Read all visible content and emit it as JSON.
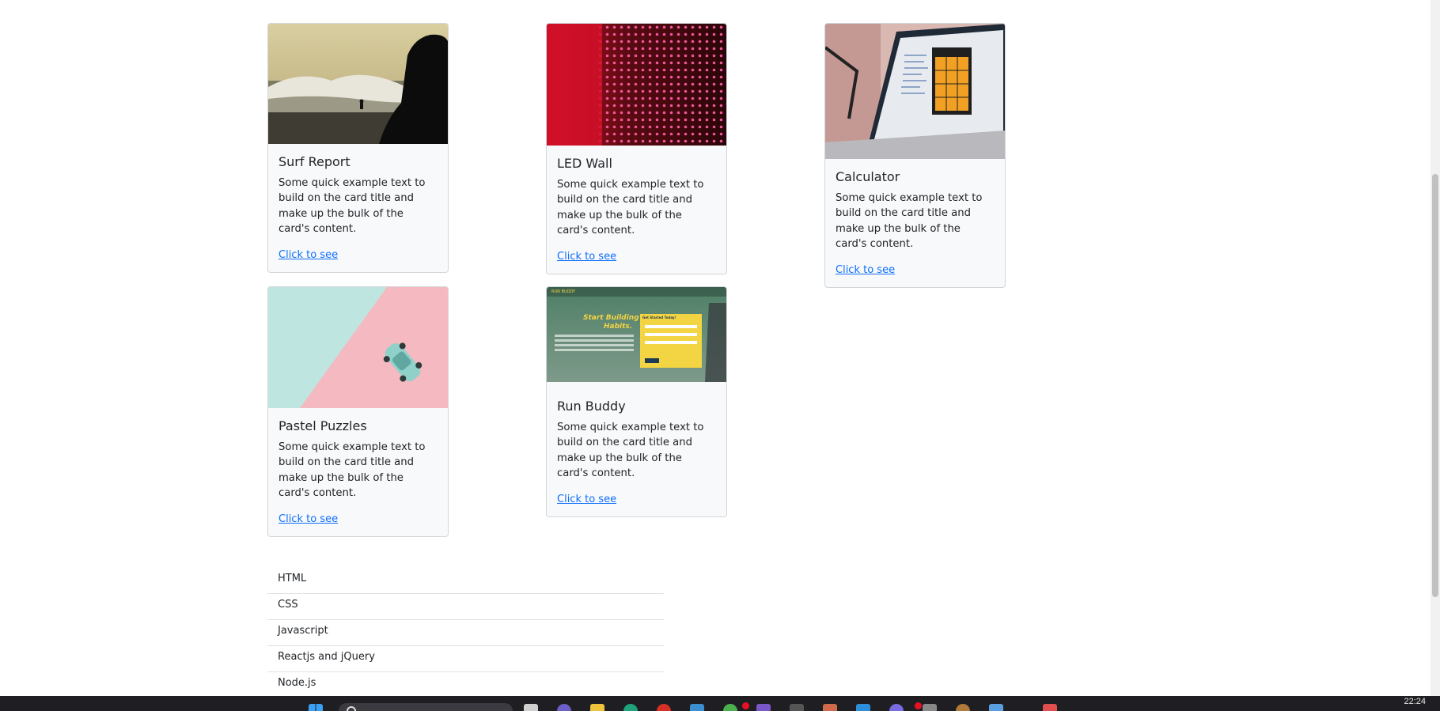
{
  "cards": [
    {
      "title": "Surf Report",
      "text": "Some quick example text to build on the card title and make up the bulk of the card's content.",
      "link": "Click to see"
    },
    {
      "title": "LED Wall",
      "text": "Some quick example text to build on the card title and make up the bulk of the card's content.",
      "link": "Click to see"
    },
    {
      "title": "Calculator",
      "text": "Some quick example text to build on the card title and make up the bulk of the card's content.",
      "link": "Click to see"
    },
    {
      "title": "Pastel Puzzles",
      "text": "Some quick example text to build on the card title and make up the bulk of the card's content.",
      "link": "Click to see"
    },
    {
      "title": "Run Buddy",
      "text": "Some quick example text to build on the card title and make up the bulk of the card's content.",
      "link": "Click to see"
    }
  ],
  "run_buddy_preview": {
    "brand": "RUN BUDDY",
    "headline_1": "Start Building",
    "headline_2": "Habits.",
    "form_title": "Get Started Today!"
  },
  "skills": [
    "HTML",
    "CSS",
    "Javascript",
    "Reactjs and jQuery",
    "Node.js"
  ],
  "taskbar": {
    "clock": "22:24",
    "icons": [
      "windows-start-icon",
      "search-icon",
      "file-explorer-icon",
      "browser-icon",
      "chrome-icon",
      "store-icon",
      "teams-icon",
      "visual-studio-icon",
      "vscode-icon",
      "calendar-icon"
    ]
  },
  "colors": {
    "link": "#0d6efd",
    "card_bg": "#f8f9fa",
    "card_border": "#d3d6d9"
  }
}
